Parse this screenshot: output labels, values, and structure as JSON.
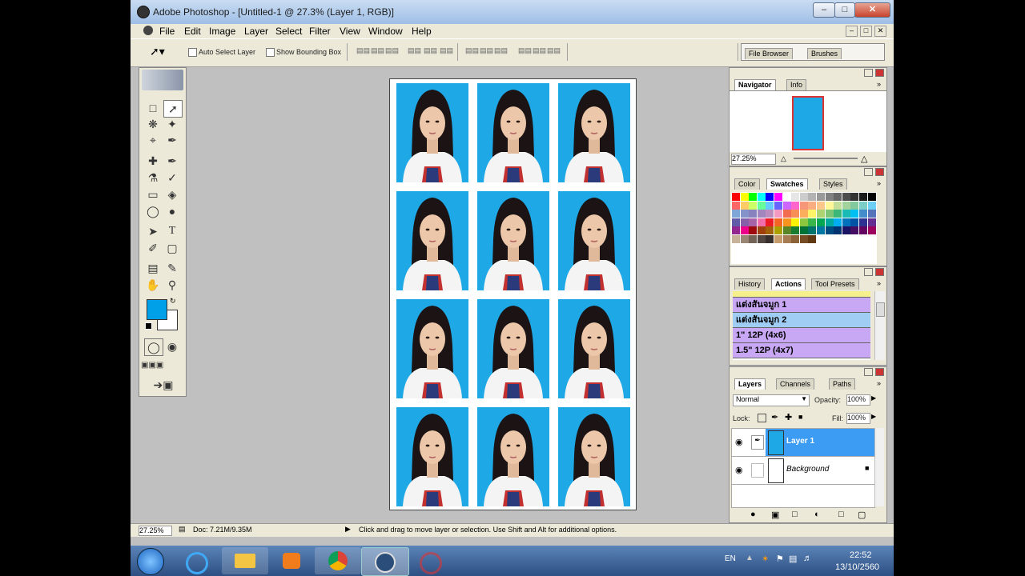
{
  "window": {
    "title": "Adobe Photoshop - [Untitled-1 @ 27.3% (Layer 1, RGB)]"
  },
  "menu": [
    "File",
    "Edit",
    "Image",
    "Layer",
    "Select",
    "Filter",
    "View",
    "Window",
    "Help"
  ],
  "options": {
    "auto_select": "Auto Select Layer",
    "show_bbox": "Show Bounding Box"
  },
  "palette_well": {
    "file_browser": "File Browser",
    "brushes": "Brushes"
  },
  "navigator": {
    "tabs": [
      "Navigator",
      "Info"
    ],
    "zoom": "27.25%"
  },
  "swatches": {
    "tabs": [
      "Color",
      "Swatches",
      "Styles"
    ],
    "colors": [
      "#ff0000",
      "#ffff00",
      "#00ff00",
      "#00ffff",
      "#0000ff",
      "#ff00ff",
      "#ffffff",
      "#e6e6e6",
      "#cccccc",
      "#b3b3b3",
      "#999999",
      "#808080",
      "#666666",
      "#4d4d4d",
      "#333333",
      "#1a1a1a",
      "#000000",
      "#ff6666",
      "#ffcc66",
      "#ccff66",
      "#66ff99",
      "#66ccff",
      "#6666ff",
      "#cc66ff",
      "#ff66cc",
      "#f7977a",
      "#fbad82",
      "#fdc68a",
      "#fff79a",
      "#c4df9b",
      "#a3d39c",
      "#82ca9d",
      "#7bcdc8",
      "#6ecff6",
      "#7ea7d8",
      "#8493ca",
      "#8882be",
      "#a187be",
      "#bc8dbf",
      "#f49ac2",
      "#f26c4f",
      "#f68e55",
      "#fbaf5c",
      "#fff467",
      "#acd372",
      "#7cc576",
      "#3bb878",
      "#1abbb4",
      "#00bff3",
      "#438ccb",
      "#5574b9",
      "#605ca8",
      "#855fa8",
      "#a763a8",
      "#f06ea9",
      "#ed1c24",
      "#f26522",
      "#f7941d",
      "#fff200",
      "#8dc73f",
      "#39b54a",
      "#00a651",
      "#00a99d",
      "#00aeef",
      "#0072bc",
      "#0054a6",
      "#2e3192",
      "#662d91",
      "#92278f",
      "#ec008c",
      "#9e0b0f",
      "#a0410d",
      "#a36209",
      "#aba000",
      "#598527",
      "#197b30",
      "#007236",
      "#00746b",
      "#0076a3",
      "#004b80",
      "#003471",
      "#1b1464",
      "#440e62",
      "#630460",
      "#9e005d",
      "#c7b299",
      "#998675",
      "#736357",
      "#534741",
      "#37302d",
      "#c69c6d",
      "#a67c52",
      "#8c6239",
      "#754c24",
      "#603913"
    ]
  },
  "actions": {
    "tabs": [
      "History",
      "Actions",
      "Tool Presets"
    ],
    "items": [
      "แต่งสันจมูก 1",
      "แต่งสันจมูก 2",
      "1\"  12P  (4x6)",
      "1.5\"  12P  (4x7)"
    ]
  },
  "layers": {
    "tabs": [
      "Layers",
      "Channels",
      "Paths"
    ],
    "blend": "Normal",
    "opacity_label": "Opacity:",
    "opacity": "100%",
    "lock_label": "Lock:",
    "fill_label": "Fill:",
    "fill": "100%",
    "items": [
      "Layer 1",
      "Background"
    ]
  },
  "status": {
    "zoom": "27.25%",
    "doc": "Doc: 7.21M/9.35M",
    "hint": "Click and drag to move layer or selection.  Use Shift and Alt for additional options."
  },
  "taskbar": {
    "lang": "EN",
    "time": "22:52",
    "date": "13/10/2560"
  }
}
